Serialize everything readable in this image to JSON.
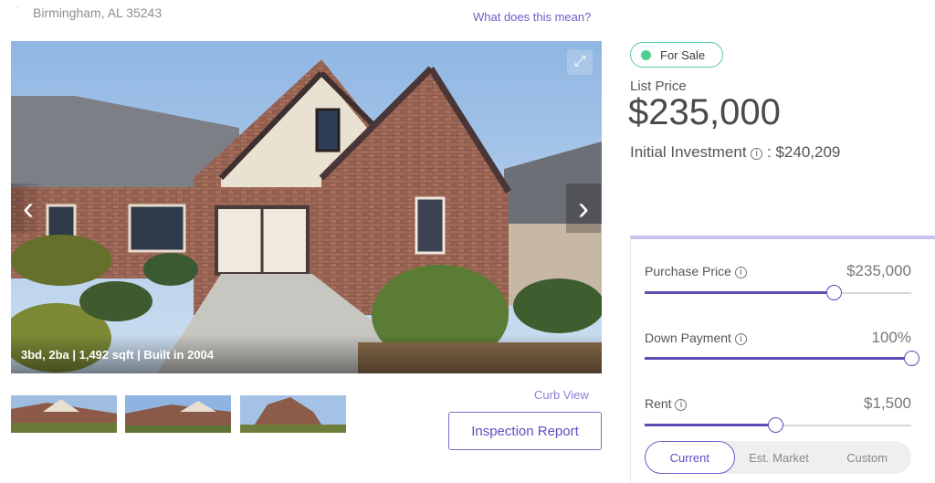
{
  "listing": {
    "address": "Birmingham, AL 35243",
    "what_link": "What does this mean?",
    "photo_caption": "3bd, 2ba | 1,492 sqft | Built in 2004",
    "curb_view_label": "Curb View",
    "inspection_button": "Inspection Report"
  },
  "summary": {
    "status": "For Sale",
    "status_color": "#4dd08f",
    "list_price_label": "List Price",
    "list_price": "$235,000",
    "initial_investment_label": "Initial Investment",
    "initial_investment_value": ": $240,209"
  },
  "calculator": {
    "accent_color": "#5a4fb3",
    "purchase_price": {
      "label": "Purchase Price",
      "value": "$235,000",
      "slider_fraction": 0.71
    },
    "down_payment": {
      "label": "Down Payment",
      "value": "100%",
      "slider_fraction": 1.0
    },
    "rent": {
      "label": "Rent",
      "value": "$1,500",
      "slider_fraction": 0.49
    },
    "rent_options": [
      "Current",
      "Est. Market",
      "Custom"
    ],
    "rent_selected": "Current"
  },
  "icons": {
    "expand": "expand-icon",
    "prev": "chevron-left-icon",
    "next": "chevron-right-icon",
    "info": "info-icon"
  }
}
